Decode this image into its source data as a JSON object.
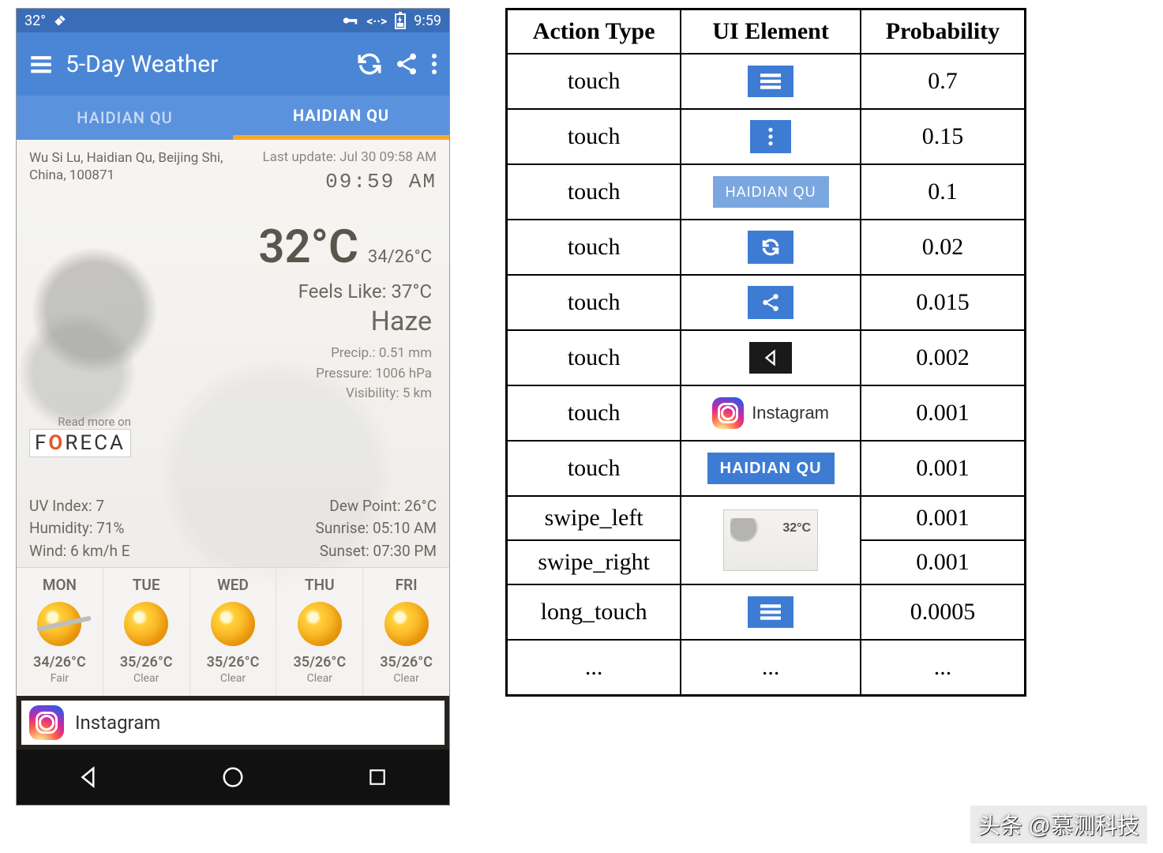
{
  "phone": {
    "status": {
      "temp": "32°",
      "time": "9:59"
    },
    "app_bar": {
      "title": "5-Day Weather"
    },
    "tabs": {
      "inactive": "HAIDIAN QU",
      "active": "HAIDIAN QU"
    },
    "location": {
      "line": "Wu Si Lu, Haidian Qu, Beijing Shi, China, 100871",
      "last_update": "Last update: Jul 30  09:58 AM",
      "clock": "09:59 AM"
    },
    "weather": {
      "temp": "32°C",
      "range": "34/26°C",
      "feels": "Feels Like: 37°C",
      "condition": "Haze",
      "precip": "Precip.: 0.51 mm",
      "pressure": "Pressure: 1006 hPa",
      "visibility": "Visibility: 5 km"
    },
    "read_more": "Read more on",
    "stats_left": {
      "uv": "UV Index: 7",
      "humidity": "Humidity: 71%",
      "wind": "Wind: 6 km/h E"
    },
    "stats_right": {
      "dew": "Dew Point: 26°C",
      "sunrise": "Sunrise: 05:10 AM",
      "sunset": "Sunset: 07:30 PM"
    },
    "forecast": [
      {
        "day": "MON",
        "temp": "34/26°C",
        "cond": "Fair"
      },
      {
        "day": "TUE",
        "temp": "35/26°C",
        "cond": "Clear"
      },
      {
        "day": "WED",
        "temp": "35/26°C",
        "cond": "Clear"
      },
      {
        "day": "THU",
        "temp": "35/26°C",
        "cond": "Clear"
      },
      {
        "day": "FRI",
        "temp": "35/26°C",
        "cond": "Clear"
      }
    ],
    "notification": {
      "label": "Instagram"
    }
  },
  "table": {
    "headers": {
      "action": "Action Type",
      "element": "UI Element",
      "prob": "Probability"
    },
    "rows": [
      {
        "action": "touch",
        "ui": "menu-icon",
        "prob": "0.7"
      },
      {
        "action": "touch",
        "ui": "more-icon",
        "prob": "0.15"
      },
      {
        "action": "touch",
        "ui": "tab-inactive",
        "prob": "0.1",
        "text": "HAIDIAN QU"
      },
      {
        "action": "touch",
        "ui": "refresh-icon",
        "prob": "0.02"
      },
      {
        "action": "touch",
        "ui": "share-icon",
        "prob": "0.015"
      },
      {
        "action": "touch",
        "ui": "back-nav",
        "prob": "0.002"
      },
      {
        "action": "touch",
        "ui": "instagram",
        "prob": "0.001",
        "text": "Instagram"
      },
      {
        "action": "touch",
        "ui": "tab-active",
        "prob": "0.001",
        "text": "HAIDIAN QU"
      },
      {
        "action": "swipe_left",
        "ui": "weather-panel",
        "prob": "0.001"
      },
      {
        "action": "swipe_right",
        "ui": "weather-panel",
        "prob": "0.001"
      },
      {
        "action": "long_touch",
        "ui": "menu-icon",
        "prob": "0.0005"
      },
      {
        "action": "...",
        "ui": "ellipsis",
        "prob": "...",
        "text": "..."
      }
    ]
  },
  "watermark": "头条 @慕测科技"
}
